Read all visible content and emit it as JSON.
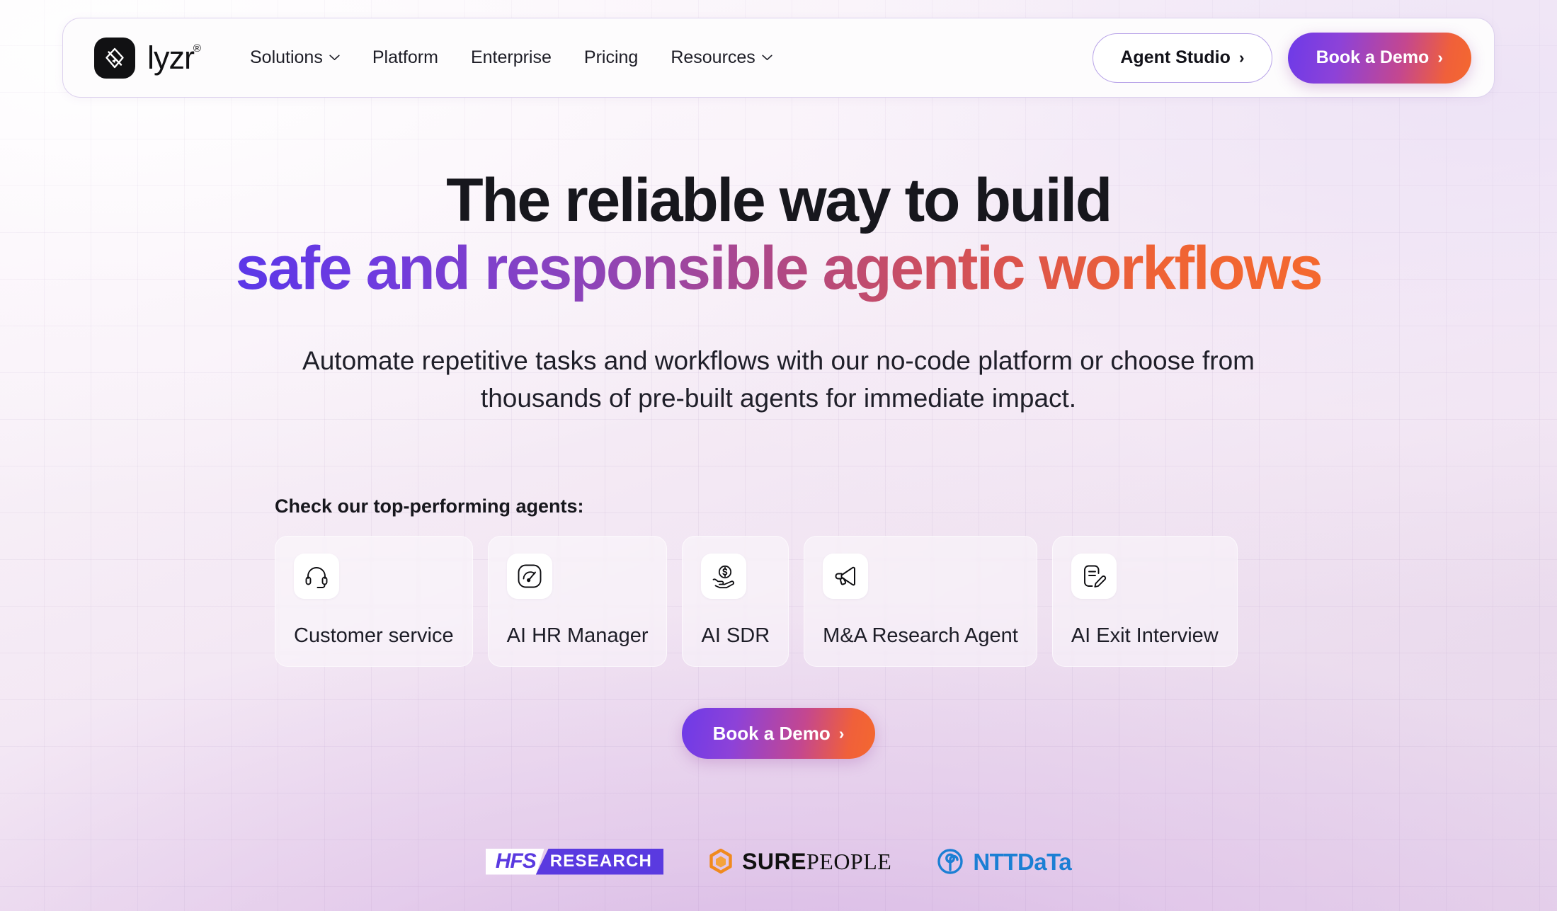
{
  "header": {
    "logo": {
      "mark": "lyzr-diamond-icon",
      "word": "lyzr",
      "trademark": "®"
    },
    "nav": [
      {
        "label": "Solutions",
        "has_chevron": true
      },
      {
        "label": "Platform",
        "has_chevron": false
      },
      {
        "label": "Enterprise",
        "has_chevron": false
      },
      {
        "label": "Pricing",
        "has_chevron": false
      },
      {
        "label": "Resources",
        "has_chevron": true
      }
    ],
    "agent_studio_label": "Agent Studio",
    "agent_studio_arrow": "›",
    "book_demo_label": "Book a Demo",
    "book_demo_arrow": "›"
  },
  "hero": {
    "headline_line1": "The reliable way to build",
    "headline_line2": "safe and responsible agentic workflows",
    "subheading": "Automate repetitive tasks and workflows with our no-code platform or choose from thousands of pre-built agents for immediate impact.",
    "cta_label": "Book a Demo",
    "cta_arrow": "›"
  },
  "agents": {
    "label": "Check our top-performing agents:",
    "cards": [
      {
        "label": "Customer service",
        "icon": "headset-icon"
      },
      {
        "label": "AI HR Manager",
        "icon": "gauge-icon"
      },
      {
        "label": "AI SDR",
        "icon": "hand-coin-icon"
      },
      {
        "label": "M&A Research Agent",
        "icon": "megaphone-icon"
      },
      {
        "label": "AI Exit Interview",
        "icon": "document-pencil-icon"
      }
    ]
  },
  "client_logos": [
    {
      "name": "HFS Research",
      "part1": "HFS",
      "part2": "RESEARCH",
      "color": "#5a3ae0"
    },
    {
      "name": "SurePeople",
      "part1": "SURE",
      "part2": "PEOPLE",
      "color": "#f08a1e"
    },
    {
      "name": "NTT DATA",
      "part1": "NTT",
      "part2": "DaTa",
      "color": "#1b7fd4"
    }
  ],
  "colors": {
    "gradient_start": "#5b37e8",
    "gradient_mid": "#b4497f",
    "gradient_end": "#f4682f",
    "text_dark": "#17171d",
    "border_purple": "#b8a3e8"
  }
}
